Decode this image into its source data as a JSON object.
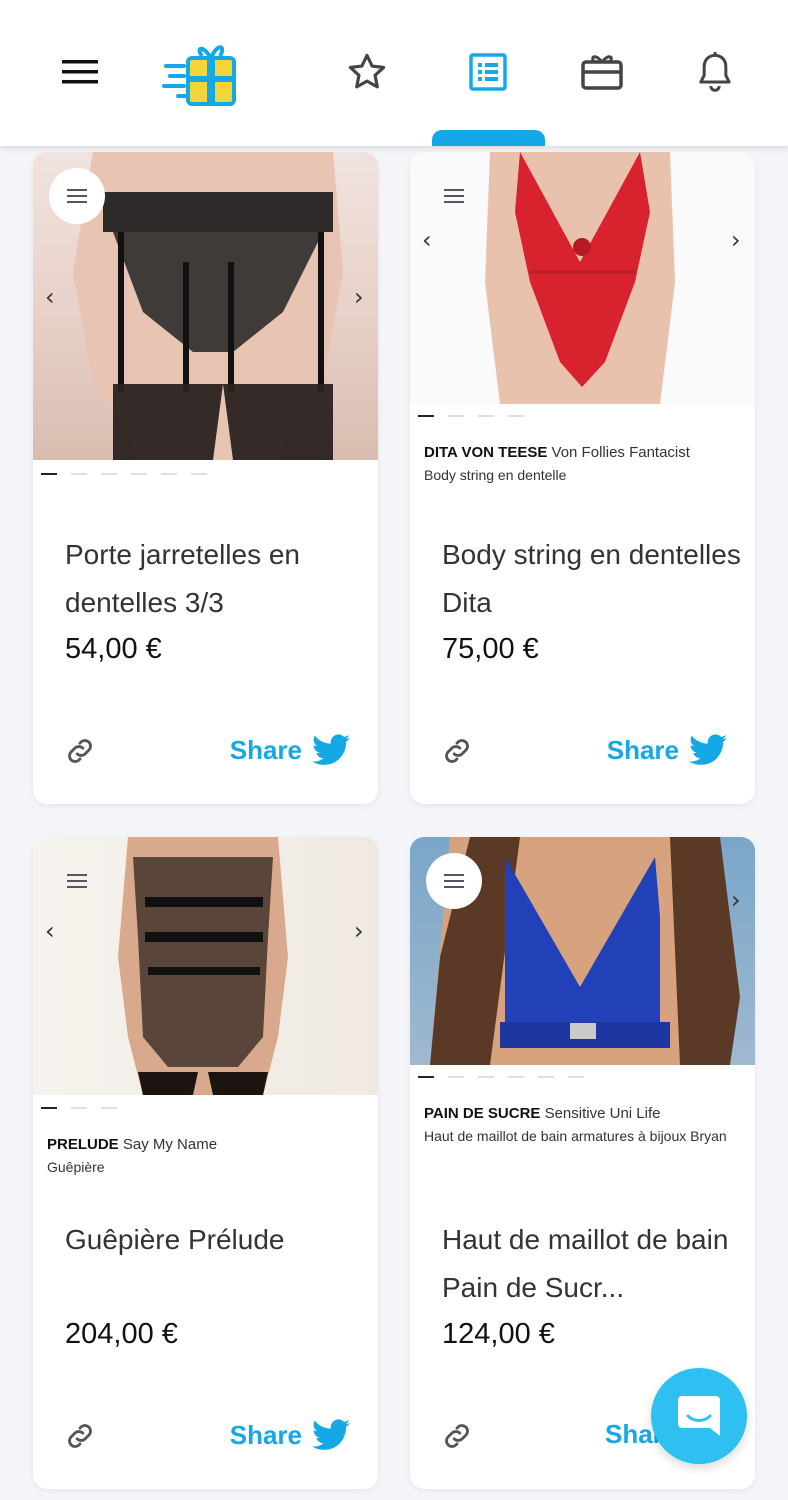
{
  "nav": {
    "icons": [
      "hamburger-menu-icon",
      "gift-logo-icon",
      "star-icon",
      "list-icon",
      "gift-card-icon",
      "bell-icon"
    ],
    "active_tab": "list-icon",
    "accent_color": "#14a9e6"
  },
  "products": [
    {
      "title": "Porte jarretelles en dentelles 3/3",
      "price": "54,00 €",
      "brand": "",
      "collection": "",
      "subtitle": "",
      "image_count": 6,
      "share_label": "Share"
    },
    {
      "title": "Body string en dentelles Dita",
      "price": "75,00 €",
      "brand": "DITA VON TEESE",
      "collection": "Von Follies Fantacist",
      "subtitle": "Body string en dentelle",
      "image_count": 4,
      "share_label": "Share"
    },
    {
      "title": "Guêpière Prélude",
      "price": "204,00 €",
      "brand": "PRELUDE",
      "collection": "Say My Name",
      "subtitle": "Guêpière",
      "image_count": 3,
      "share_label": "Share"
    },
    {
      "title": "Haut de maillot de bain Pain de Sucr...",
      "price": "124,00 €",
      "brand": "PAIN DE SUCRE",
      "collection": "Sensitive Uni Life",
      "subtitle": "Haut de maillot de bain armatures à bijoux Bryan",
      "image_count": 6,
      "share_label": "Shar"
    }
  ],
  "chat": {
    "icon": "chat-bubble-icon",
    "color": "#2ec0f0"
  }
}
